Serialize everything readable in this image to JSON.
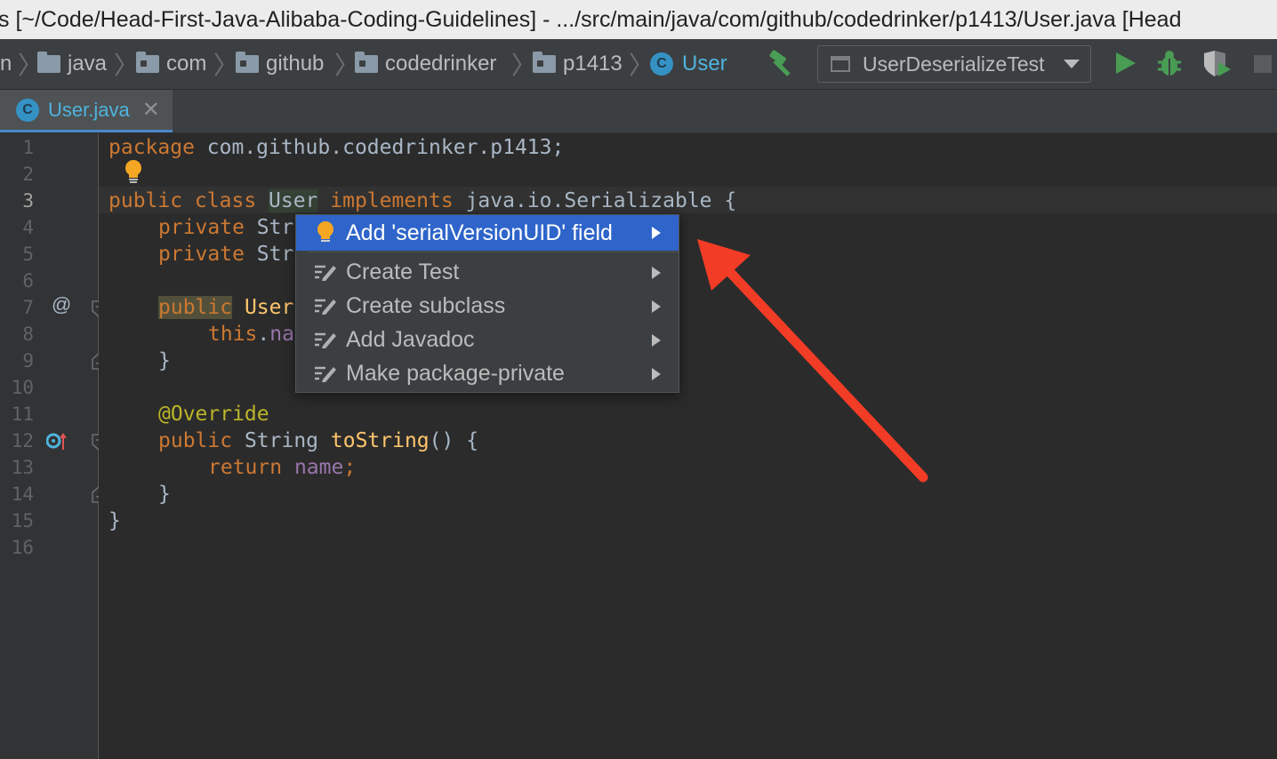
{
  "window": {
    "title": "s [~/Code/Head-First-Java-Alibaba-Coding-Guidelines] - .../src/main/java/com/github/codedrinker/p1413/User.java [Head"
  },
  "breadcrumbs": [
    {
      "label": "n",
      "icon": "none"
    },
    {
      "label": "java",
      "icon": "folder-icon"
    },
    {
      "label": "com",
      "icon": "package-icon"
    },
    {
      "label": "github",
      "icon": "package-icon"
    },
    {
      "label": "codedrinker",
      "icon": "package-icon"
    },
    {
      "label": "p1413",
      "icon": "package-icon"
    },
    {
      "label": "User",
      "icon": "class-icon"
    }
  ],
  "toolbar": {
    "run_config": "UserDeserializeTest",
    "class_badge": "C"
  },
  "tabs": [
    {
      "label": "User.java",
      "active": true
    }
  ],
  "gutter": {
    "line_numbers": [
      "1",
      "2",
      "3",
      "4",
      "5",
      "6",
      "7",
      "8",
      "9",
      "10",
      "11",
      "12",
      "13",
      "14",
      "15",
      "16"
    ],
    "current_line": "3",
    "marker_line7": "@"
  },
  "code": {
    "l1_kw": "package",
    "l1_rest": " com.github.codedrinker.p1413;",
    "l3_kw1": "public class ",
    "l3_cls": "User",
    "l3_kw2": " implements",
    "l3_rest": " java.io.Serializable {",
    "l4_kw": "private",
    "l4_rest": " Str",
    "l5_kw": "private",
    "l5_rest": " Str",
    "l7_kw": "public",
    "l7_rest": " User",
    "l8_kw": "this",
    "l8_dot": ".",
    "l8_fld": "na",
    "l9": "}",
    "l11": "@Override",
    "l12_kw": "public",
    "l12_type": " String ",
    "l12_mth": "toString",
    "l12_rest": "() {",
    "l13_kw": "return",
    "l13_fld": " name",
    "l13_semi": ";",
    "l14": "}",
    "l15": "}"
  },
  "intention_popup": {
    "selected": "Add 'serialVersionUID' field",
    "items": [
      "Create Test",
      "Create subclass",
      "Add Javadoc",
      "Make package-private"
    ]
  },
  "colors": {
    "accent": "#2f65ca",
    "arrow": "#f23c26",
    "class_icon": "#3592c4"
  }
}
